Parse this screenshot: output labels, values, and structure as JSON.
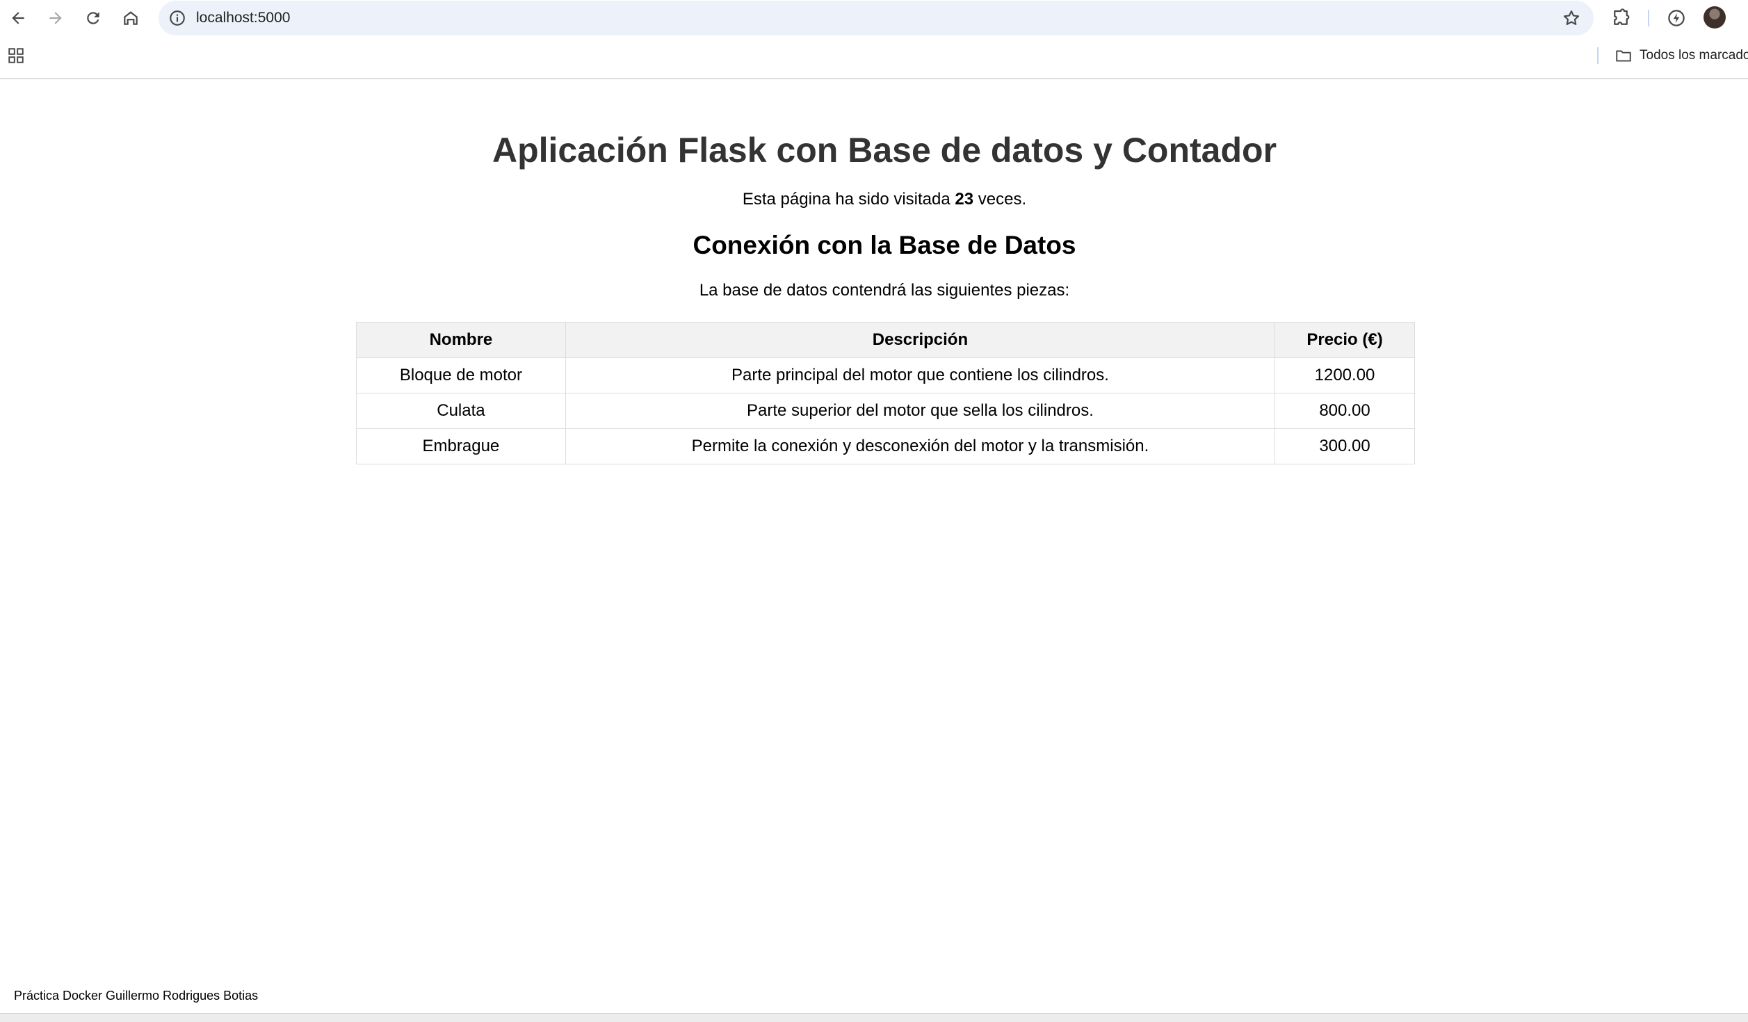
{
  "browser": {
    "url": "localhost:5000",
    "bookmarks_folder_label": "Todos los marcador"
  },
  "page": {
    "title": "Aplicación Flask con Base de datos y Contador",
    "visits_prefix": "Esta página ha sido visitada ",
    "visits_count": "23",
    "visits_suffix": " veces.",
    "db_heading": "Conexión con la Base de Datos",
    "db_intro": "La base de datos contendrá las siguientes piezas:",
    "table": {
      "headers": [
        "Nombre",
        "Descripción",
        "Precio (€)"
      ],
      "rows": [
        [
          "Bloque de motor",
          "Parte principal del motor que contiene los cilindros.",
          "1200.00"
        ],
        [
          "Culata",
          "Parte superior del motor que sella los cilindros.",
          "800.00"
        ],
        [
          "Embrague",
          "Permite la conexión y desconexión del motor y la transmisión.",
          "300.00"
        ]
      ]
    },
    "footer": "Práctica Docker Guillermo Rodrigues Botias"
  },
  "icons": {
    "back": "back-arrow-icon",
    "forward": "forward-arrow-icon",
    "reload": "reload-icon",
    "home": "home-icon",
    "site_info": "site-info-icon",
    "bookmark_star": "star-icon",
    "extensions": "puzzle-icon",
    "performance": "performance-icon",
    "apps": "apps-grid-icon",
    "folder": "folder-icon"
  },
  "colors": {
    "omnibox_bg": "#edf2fa",
    "title_text": "#333333",
    "table_header_bg": "#f2f2f2",
    "table_border": "#dddddd"
  }
}
